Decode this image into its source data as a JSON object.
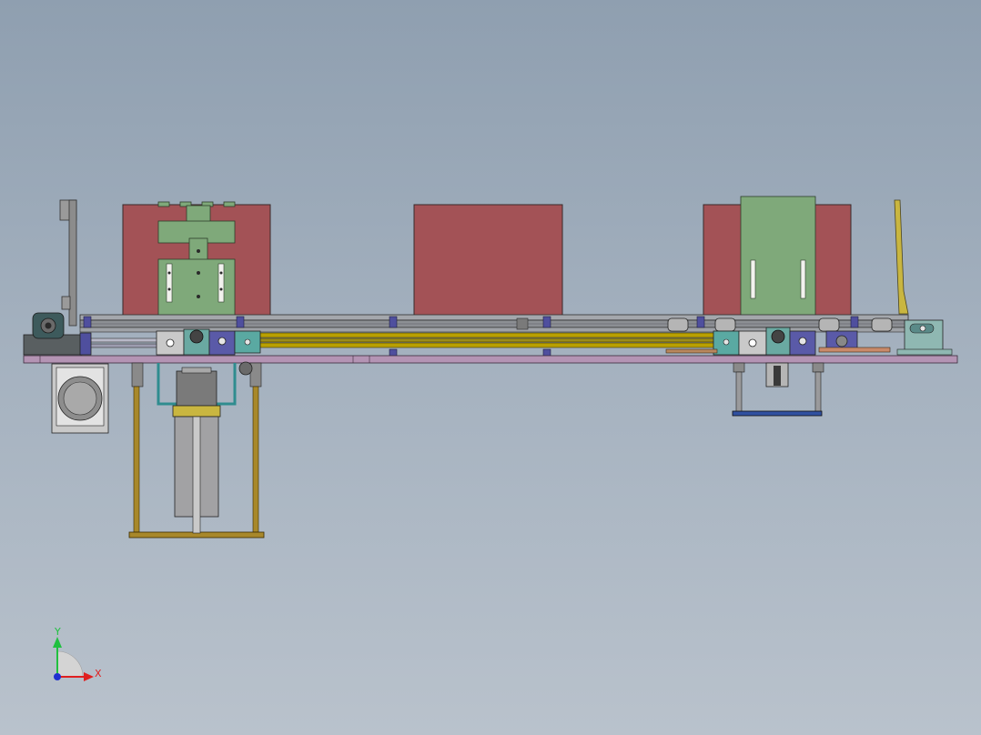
{
  "viewport": {
    "background": [
      "#8f9fb0",
      "#b9c2cc"
    ]
  },
  "triad": {
    "x_label": "X",
    "y_label": "Y",
    "x_color": "#e02020",
    "y_color": "#20c040",
    "z_color": "#2030d0"
  },
  "colors": {
    "product_box": "#a35256",
    "frame": "#b494b4",
    "rail": "#8c8f94",
    "guide_rod": "#b9a000",
    "bracket_green": "#7fa97a",
    "block_teal": "#5aa9a2",
    "block_blue": "#5a5aa8",
    "cylinder": "#9a9a9c",
    "mount_plate": "#3050a0"
  }
}
